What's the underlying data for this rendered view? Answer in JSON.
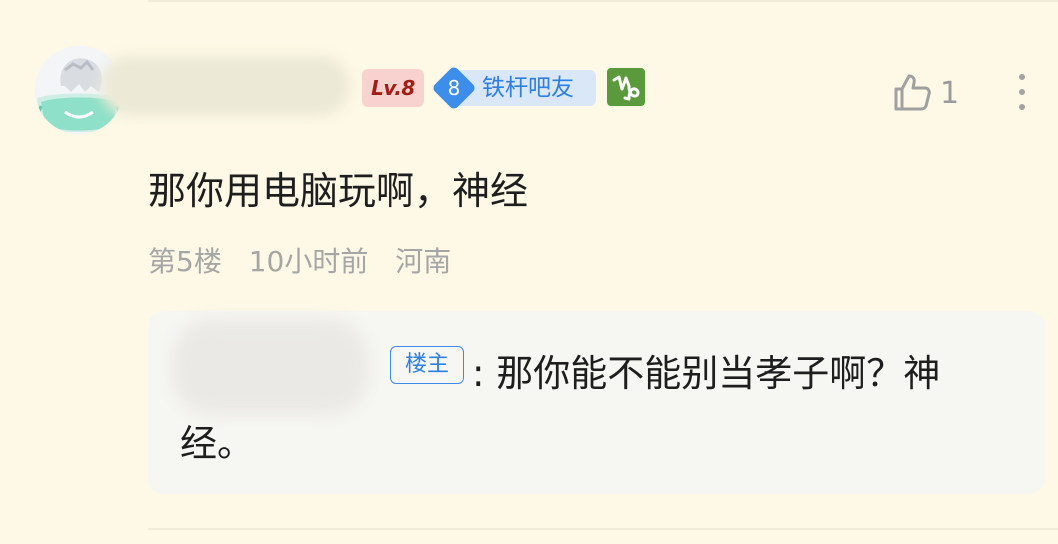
{
  "post": {
    "user": {
      "name": "",
      "level_badge": "Lv.8",
      "fan_level": "8",
      "fan_title": "铁杆吧友",
      "zodiac": "capricorn-icon"
    },
    "likes": "1",
    "content": "那你用电脑玩啊，神经",
    "meta": {
      "floor": "第5楼",
      "time": "10小时前",
      "location": "河南"
    },
    "reply": {
      "author": "",
      "author_tag": "楼主",
      "text": ": 那你能不能别当孝子啊？神经。"
    }
  },
  "colors": {
    "background": "#fdf9e6",
    "level_badge_bg": "#f8d2cf",
    "level_badge_text": "#a11d16",
    "fan_badge_accent": "#3d8eea",
    "zodiac_bg": "#5a9a3c",
    "reply_box_bg": "#f6f6f3",
    "meta_text": "#a6a6a6"
  }
}
